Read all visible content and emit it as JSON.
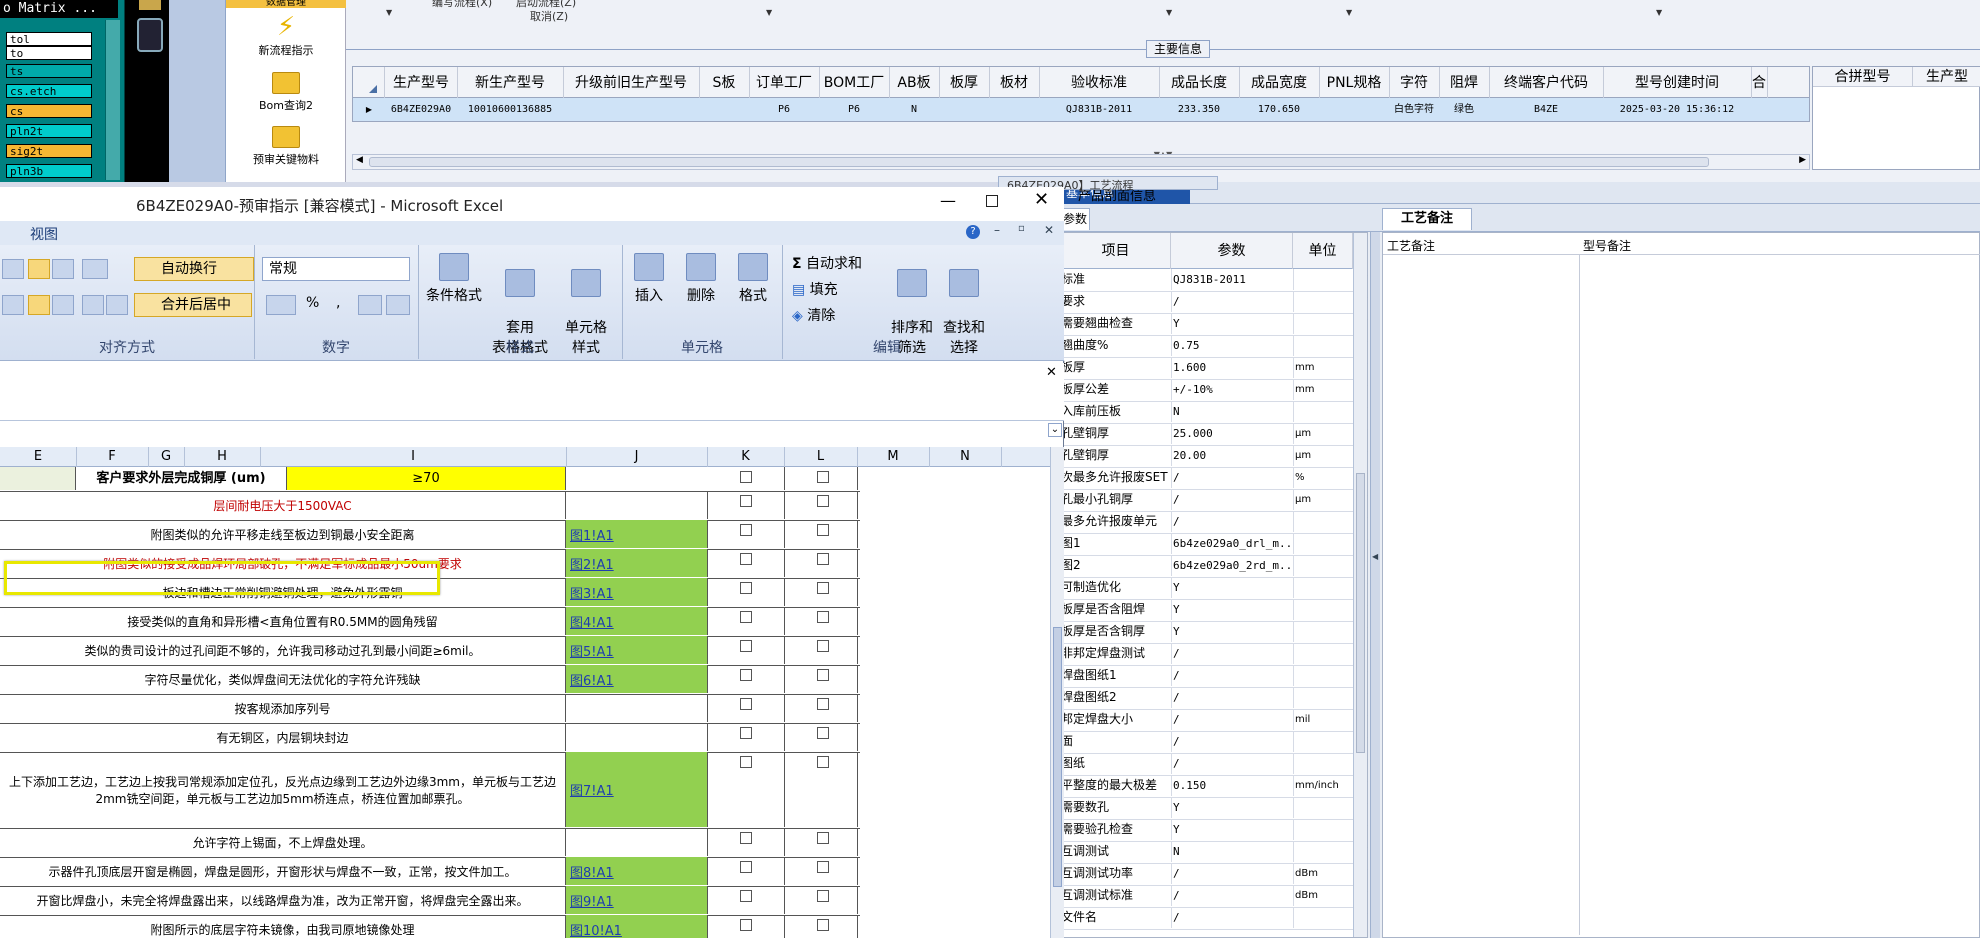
{
  "left_panel": {
    "title": "o Matrix ...",
    "items": [
      {
        "label": "tol",
        "color": "#ffffff"
      },
      {
        "label": "to",
        "color": "#ffffff"
      },
      {
        "label": "ts",
        "color": "#00aaaa"
      },
      {
        "label": "cs.etch",
        "color": "#00cccc"
      },
      {
        "label": "cs",
        "color": "#f7b733"
      },
      {
        "label": "pln2t",
        "color": "#00cccc"
      },
      {
        "label": "sig2t",
        "color": "#f7b733"
      },
      {
        "label": "pln3b",
        "color": "#00cccc"
      }
    ]
  },
  "icon_menu": {
    "top_label": "数据管理",
    "items": [
      "新流程指示",
      "Bom查询2",
      "预审关键物料"
    ]
  },
  "top_app": {
    "menu_fragments": [
      "编写流程(X)",
      "启动流程(Z)",
      "取消(Z)"
    ],
    "section_title": "主要信息",
    "columns": [
      "生产型号",
      "新生产型号",
      "升级前旧生产型号",
      "S板",
      "订单工厂",
      "BOM工厂",
      "AB板",
      "板厚",
      "板材",
      "验收标准",
      "成品长度",
      "成品宽度",
      "PNL规格",
      "字符",
      "阻焊",
      "终端客户代码",
      "型号创建时间",
      "合"
    ],
    "row": [
      "6B4ZE029A0",
      "10010600136885",
      "",
      "",
      "P6",
      "P6",
      "N",
      "",
      "",
      "QJ831B-2011",
      "233.350",
      "170.650",
      "",
      "白色字符",
      "绿色",
      "B4ZE",
      "2025-03-20 15:36:12",
      ""
    ],
    "combine_columns": [
      "合拼型号",
      "生产型"
    ]
  },
  "bottom_right": {
    "tabs": [
      "6B4ZE029A0】工艺流程",
      "基本信息",
      "产品剖面信息"
    ],
    "prop_tab": "参数",
    "memo_tab": "工艺备注",
    "prop_headers": [
      "项目",
      "参数",
      "单位"
    ],
    "memo_headers": [
      "工艺备注",
      "型号备注"
    ],
    "props": [
      {
        "item": "标准",
        "value": "QJ831B-2011",
        "unit": "",
        "flag": "Y"
      },
      {
        "item": "要求",
        "value": "/",
        "unit": "",
        "flag": "Y"
      },
      {
        "item": "需要翘曲检查",
        "value": "Y",
        "unit": "",
        "flag": "Y"
      },
      {
        "item": "翘曲度%",
        "value": "0.75",
        "unit": "",
        "flag": "Y"
      },
      {
        "item": "板厚",
        "value": "1.600",
        "unit": "mm",
        "flag": "Y"
      },
      {
        "item": "板厚公差",
        "value": "+/-10%",
        "unit": "mm",
        "flag": "Y"
      },
      {
        "item": "入库前压板",
        "value": "N",
        "unit": "",
        "flag": "Y"
      },
      {
        "item": "孔壁铜厚",
        "value": "25.000",
        "unit": "μm",
        "flag": "Y"
      },
      {
        "item": "孔壁铜厚",
        "value": "20.00",
        "unit": "μm",
        "flag": "Y"
      },
      {
        "item": "次最多允许报废SET",
        "value": "/",
        "unit": "%",
        "flag": "Y"
      },
      {
        "item": "孔最小孔铜厚",
        "value": "/",
        "unit": "μm",
        "flag": "Y"
      },
      {
        "item": "最多允许报废单元",
        "value": "/",
        "unit": "",
        "flag": "Y"
      },
      {
        "item": "图1",
        "value": "6b4ze029a0_drl_m...",
        "unit": "",
        "flag": "Y"
      },
      {
        "item": "图2",
        "value": "6b4ze029a0_2rd_m...",
        "unit": "",
        "flag": "Y"
      },
      {
        "item": "可制造优化",
        "value": "Y",
        "unit": "",
        "flag": "Y"
      },
      {
        "item": "板厚是否含阻焊",
        "value": "Y",
        "unit": "",
        "flag": "Y"
      },
      {
        "item": "板厚是否含铜厚",
        "value": "Y",
        "unit": "",
        "flag": "Y"
      },
      {
        "item": "非邦定焊盘测试",
        "value": "/",
        "unit": "",
        "flag": "Y"
      },
      {
        "item": "焊盘图纸1",
        "value": "/",
        "unit": "",
        "flag": "Y"
      },
      {
        "item": "焊盘图纸2",
        "value": "/",
        "unit": "",
        "flag": "Y"
      },
      {
        "item": "邦定焊盘大小",
        "value": "/",
        "unit": "mil",
        "flag": "Y"
      },
      {
        "item": "面",
        "value": "/",
        "unit": "",
        "flag": "Y"
      },
      {
        "item": "图纸",
        "value": "/",
        "unit": "",
        "flag": "Y"
      },
      {
        "item": "平整度的最大极差",
        "value": "0.150",
        "unit": "mm/inch",
        "flag": "Y"
      },
      {
        "item": "需要数孔",
        "value": "Y",
        "unit": "",
        "flag": "Y"
      },
      {
        "item": "需要验孔检查",
        "value": "Y",
        "unit": "",
        "flag": "Y"
      },
      {
        "item": "互调测试",
        "value": "N",
        "unit": "",
        "flag": "Y"
      },
      {
        "item": "互调测试功率",
        "value": "/",
        "unit": "dBm",
        "flag": "Y"
      },
      {
        "item": "互调测试标准",
        "value": "/",
        "unit": "dBm",
        "flag": "Y"
      },
      {
        "item": "文件名",
        "value": "/",
        "unit": "",
        "flag": "Y"
      }
    ]
  },
  "excel": {
    "title": "6B4ZE029A0-预审指示  [兼容模式] - Microsoft Excel",
    "menu_item": "视图",
    "ribbon": {
      "wrap": "自动换行",
      "merge": "合并后居中",
      "align_group": "对齐方式",
      "number_format": "常规",
      "number_group": "数字",
      "cond_format": "条件格式",
      "table_format": "套用\n表格格式",
      "cell_style": "单元格\n样式",
      "style_group": "样式",
      "insert": "插入",
      "delete": "删除",
      "format": "格式",
      "cells_group": "单元格",
      "autosum": "自动求和",
      "fill": "填充",
      "clear": "清除",
      "sort": "排序和\n筛选",
      "find": "查找和\n选择",
      "edit_group": "编辑"
    },
    "col_headers": [
      "E",
      "F",
      "G",
      "H",
      "I",
      "J",
      "K",
      "L",
      "M",
      "N"
    ],
    "header_row": {
      "label": "客户要求外层完成铜厚 (um)",
      "value": "≥70"
    },
    "rows": [
      {
        "text": "层间耐电压大于1500VAC",
        "link": "",
        "red": true
      },
      {
        "text": "附图类似的允许平移走线至板边到铜最小安全距离",
        "link": "图1!A1",
        "red": false
      },
      {
        "text": "附图类似的接受成品焊环局部破孔，不满足军标成品最小50um要求",
        "link": "图2!A1",
        "red": true
      },
      {
        "text": "板边和槽边正常削铜避铜处理，避免外形露铜",
        "link": "图3!A1",
        "red": false
      },
      {
        "text": "接受类似的直角和异形槽<直角位置有R0.5MM的圆角残留",
        "link": "图4!A1",
        "red": false
      },
      {
        "text": "类似的贵司设计的过孔间距不够的，允许我司移动过孔到最小间距≥6mil。",
        "link": "图5!A1",
        "red": false
      },
      {
        "text": "字符尽量优化，类似焊盘间无法优化的字符允许残缺",
        "link": "图6!A1",
        "red": false
      },
      {
        "text": "按客规添加序列号",
        "link": "",
        "red": false
      },
      {
        "text": "有无铜区，内层铜块封边",
        "link": "",
        "red": false
      },
      {
        "text": "上下添加工艺边，工艺边上按我司常规添加定位孔，反光点边缘到工艺边外边缘3mm，单元板与工艺边2mm铣空间距，单元板与工艺边加5mm桥连点，桥连位置加邮票孔。",
        "link": "图7!A1",
        "red": false
      },
      {
        "text": "允许字符上锡面，不上焊盘处理。",
        "link": "",
        "red": false
      },
      {
        "text": "示器件孔顶底层开窗是椭圆，焊盘是圆形，开窗形状与焊盘不一致，正常，按文件加工。",
        "link": "图8!A1",
        "red": false
      },
      {
        "text": "开窗比焊盘小，未完全将焊盘露出来，以线路焊盘为准，改为正常开窗，将焊盘完全露出来。",
        "link": "图9!A1",
        "red": false
      },
      {
        "text": "附图所示的底层字符未镜像，由我司原地镜像处理",
        "link": "图10!A1",
        "red": false
      }
    ]
  }
}
